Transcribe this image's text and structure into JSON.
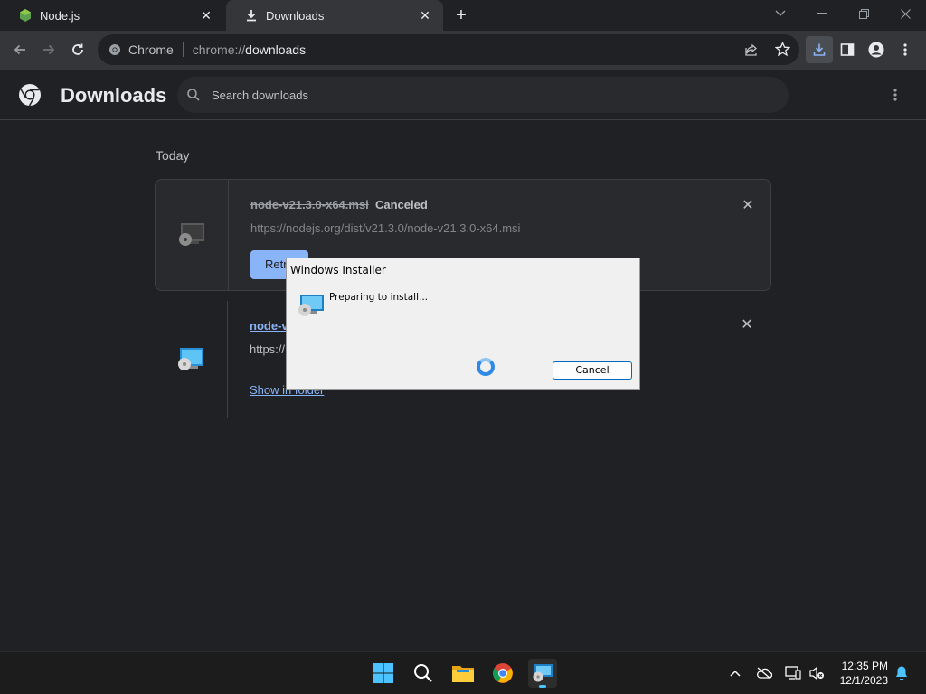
{
  "tabs": [
    {
      "title": "Node.js",
      "icon": "nodejs-icon",
      "active": false
    },
    {
      "title": "Downloads",
      "icon": "download-icon",
      "active": true
    }
  ],
  "omnibox": {
    "chip": "Chrome",
    "url_scheme": "chrome://",
    "url_host": "downloads"
  },
  "page": {
    "title": "Downloads",
    "search_placeholder": "Search downloads",
    "section": "Today"
  },
  "downloads": [
    {
      "filename": "node-v21.3.0-x64.msi",
      "status": "Canceled",
      "url": "https://nodejs.org/dist/v21.3.0/node-v21.3.0-x64.msi",
      "action": "Retr"
    },
    {
      "filename": "node-v",
      "url": "https://",
      "action": "Show in folder"
    }
  ],
  "dialog": {
    "title": "Windows Installer",
    "message": "Preparing to install...",
    "cancel": "Cancel"
  },
  "taskbar": {
    "time": "12:35 PM",
    "date": "12/1/2023"
  },
  "colors": {
    "accent": "#8ab4f8",
    "page_bg": "#202124",
    "toolbar_bg": "#35363a"
  }
}
